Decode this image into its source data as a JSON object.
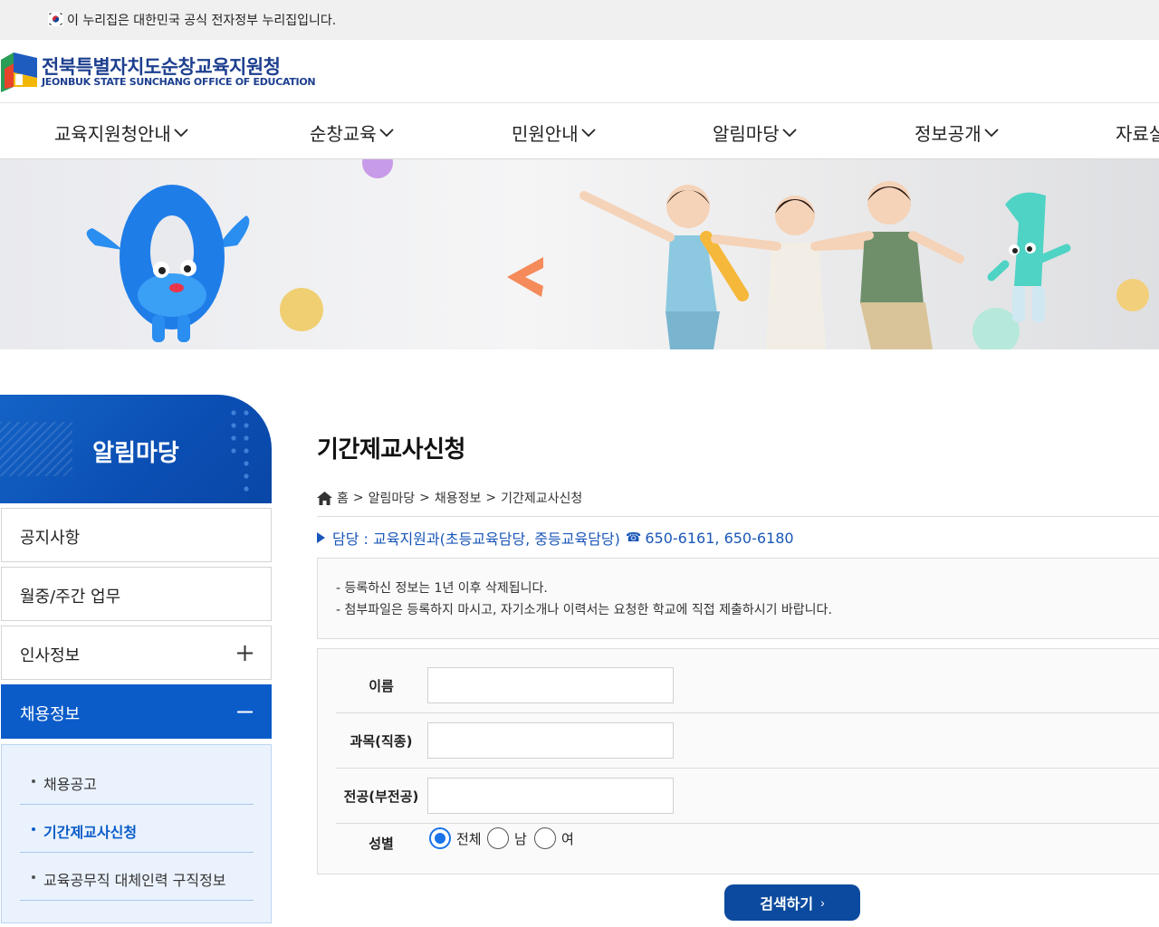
{
  "gov_banner": {
    "text": "이 누리집은 대한민국 공식 전자정부 누리집입니다."
  },
  "header": {
    "org_name_ko": "전북특별자치도순창교육지원청",
    "org_name_en": "JEONBUK STATE SUNCHANG OFFICE OF EDUCATION"
  },
  "gnb": {
    "items": [
      {
        "label": "교육지원청안내"
      },
      {
        "label": "순창교육"
      },
      {
        "label": "민원안내"
      },
      {
        "label": "알림마당"
      },
      {
        "label": "정보공개"
      },
      {
        "label": "자료실"
      }
    ]
  },
  "sidebar": {
    "title": "알림마당",
    "items": [
      {
        "label": "공지사항"
      },
      {
        "label": "월중/주간 업무"
      },
      {
        "label": "인사정보",
        "toggle": "plus"
      },
      {
        "label": "채용정보",
        "toggle": "minus",
        "active": true
      }
    ],
    "sub_items": [
      {
        "label": "채용공고"
      },
      {
        "label": "기간제교사신청",
        "active": true
      },
      {
        "label": "교육공무직 대체인력 구직정보"
      }
    ]
  },
  "content": {
    "title": "기간제교사신청",
    "breadcrumb": [
      "홈",
      "알림마당",
      "채용정보",
      "기간제교사신청"
    ],
    "breadcrumb_sep": ">",
    "contact": {
      "text": "담당 : 교육지원과(초등교육담당, 중등교육담당)",
      "phones": "650-6161, 650-6180"
    },
    "notices": [
      "- 등록하신 정보는 1년 이후 삭제됩니다.",
      "- 첨부파일은 등록하지 마시고, 자기소개나 이력서는 요청한 학교에 직접 제출하시기 바랍니다."
    ],
    "form": {
      "name_label": "이름",
      "subject_label": "과목(직종)",
      "major_label": "전공(부전공)",
      "gender_label": "성별",
      "gender_options": [
        "전체",
        "남",
        "여"
      ],
      "gender_selected": "전체"
    },
    "search_button": "검색하기"
  },
  "colors": {
    "brand_blue": "#0b5cc9",
    "button_navy": "#0b4a9e",
    "link_blue": "#1a56b8"
  }
}
